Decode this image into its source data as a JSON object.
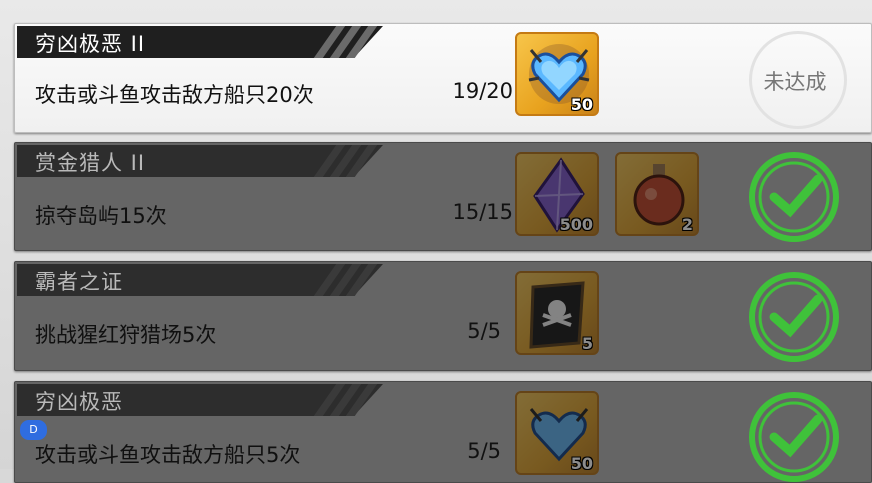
{
  "quests": [
    {
      "title": "穷凶极恶 II",
      "description": "攻击或斗鱼攻击敌方船只20次",
      "progress": "19/20",
      "state": "in-progress",
      "status_label": "未达成",
      "rewards": [
        {
          "icon": "blue-heart-gem-icon",
          "count": "50"
        }
      ]
    },
    {
      "title": "赏金猎人 II",
      "description": "掠夺岛屿15次",
      "progress": "15/15",
      "state": "completed",
      "rewards": [
        {
          "icon": "purple-crystal-icon",
          "count": "500"
        },
        {
          "icon": "red-potion-flask-icon",
          "count": "2"
        }
      ]
    },
    {
      "title": "霸者之证",
      "description": "挑战猩红狩猎场5次",
      "progress": "5/5",
      "state": "completed",
      "rewards": [
        {
          "icon": "pirate-map-scroll-icon",
          "count": "5"
        }
      ]
    },
    {
      "title": "穷凶极恶",
      "description": "攻击或斗鱼攻击敌方船只5次",
      "progress": "5/5",
      "state": "completed",
      "rewards": [
        {
          "icon": "blue-heart-gem-icon",
          "count": "50"
        }
      ]
    }
  ],
  "overlay_badge": "D",
  "colors": {
    "check_green": "#3fc23a",
    "reward_gold": "#f0b53a"
  }
}
